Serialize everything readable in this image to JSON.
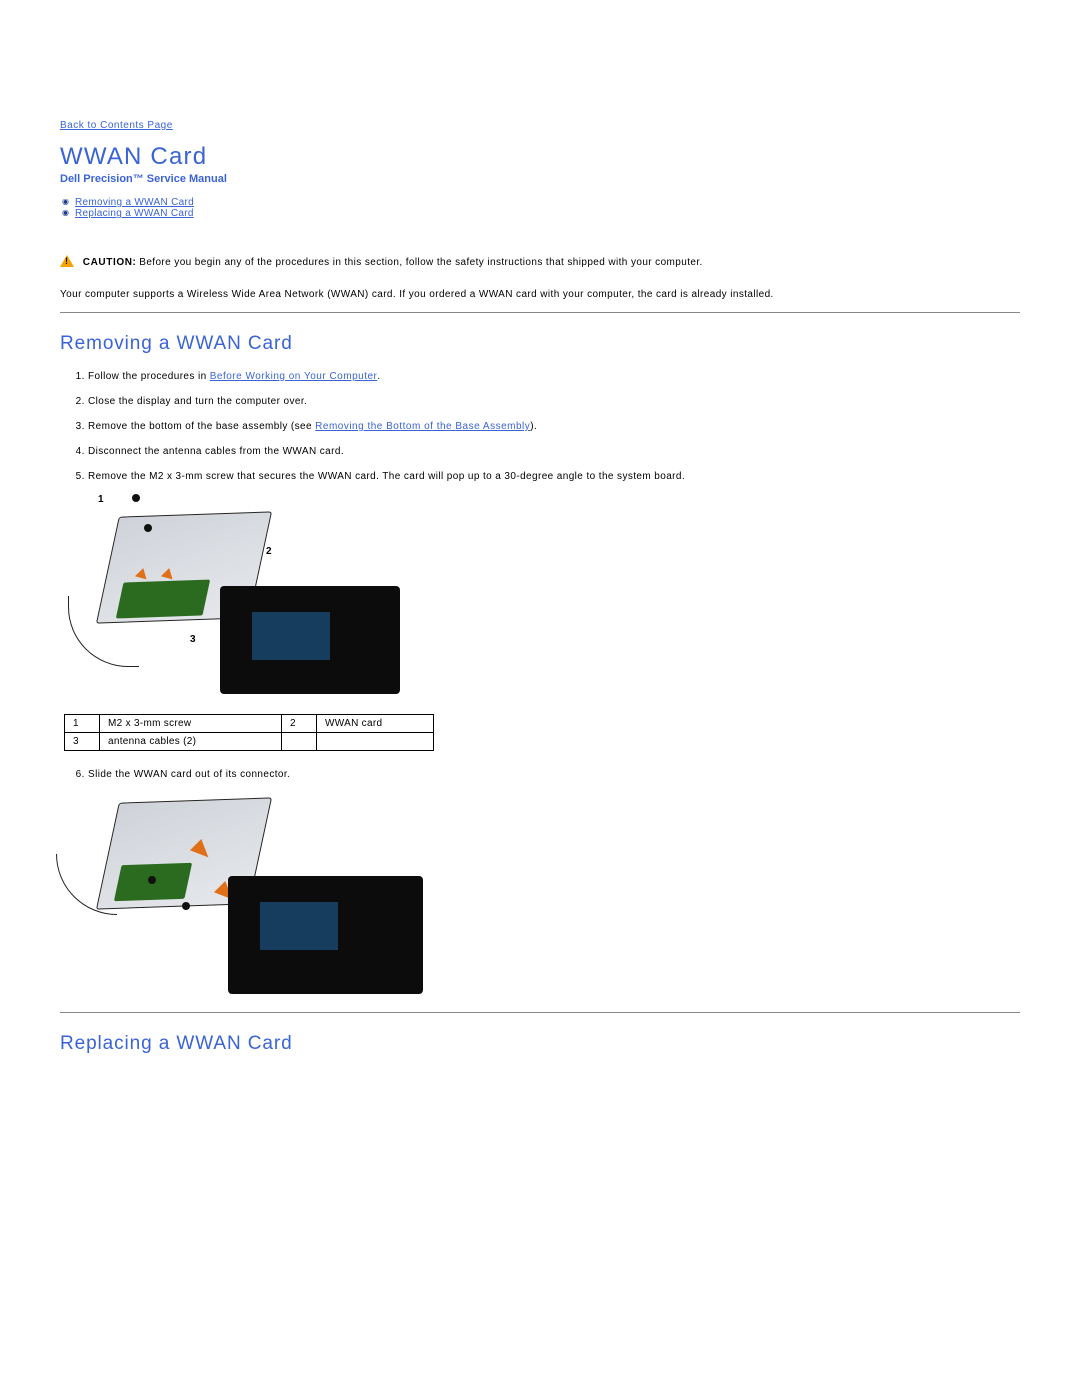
{
  "nav": {
    "back": "Back to Contents Page"
  },
  "page": {
    "title": "WWAN Card",
    "subtitle": "Dell Precision™ Service Manual"
  },
  "toc": [
    "Removing a WWAN Card",
    "Replacing a WWAN Card"
  ],
  "caution": {
    "label": "CAUTION:",
    "text": " Before you begin any of the procedures in this section, follow the safety instructions that shipped with your computer."
  },
  "intro": "Your computer supports a Wireless Wide Area Network (WWAN) card. If you ordered a WWAN card with your computer, the card is already installed.",
  "section_remove": {
    "heading": "Removing a WWAN Card",
    "steps": {
      "s1a": "Follow the procedures in ",
      "s1_link": "Before Working on Your Computer",
      "s1b": ".",
      "s2": "Close the display and turn the computer over.",
      "s3a": "Remove the bottom of the base assembly (see ",
      "s3_link": "Removing the Bottom of the Base Assembly",
      "s3b": ").",
      "s4": "Disconnect the antenna cables from the WWAN card.",
      "s5": "Remove the M2 x 3-mm screw that secures the WWAN card. The card will pop up to a 30-degree angle to the system board.",
      "s6": "Slide the WWAN card out of its connector."
    }
  },
  "callouts": {
    "c1": "1",
    "c2": "2",
    "c3": "3"
  },
  "parts_table": {
    "r1c1": "1",
    "r1c2": "M2 x 3-mm screw",
    "r1c3": "2",
    "r1c4": "WWAN card",
    "r2c1": "3",
    "r2c2": "antenna cables (2)",
    "r2c3": "",
    "r2c4": ""
  },
  "section_replace": {
    "heading": "Replacing a WWAN Card"
  }
}
